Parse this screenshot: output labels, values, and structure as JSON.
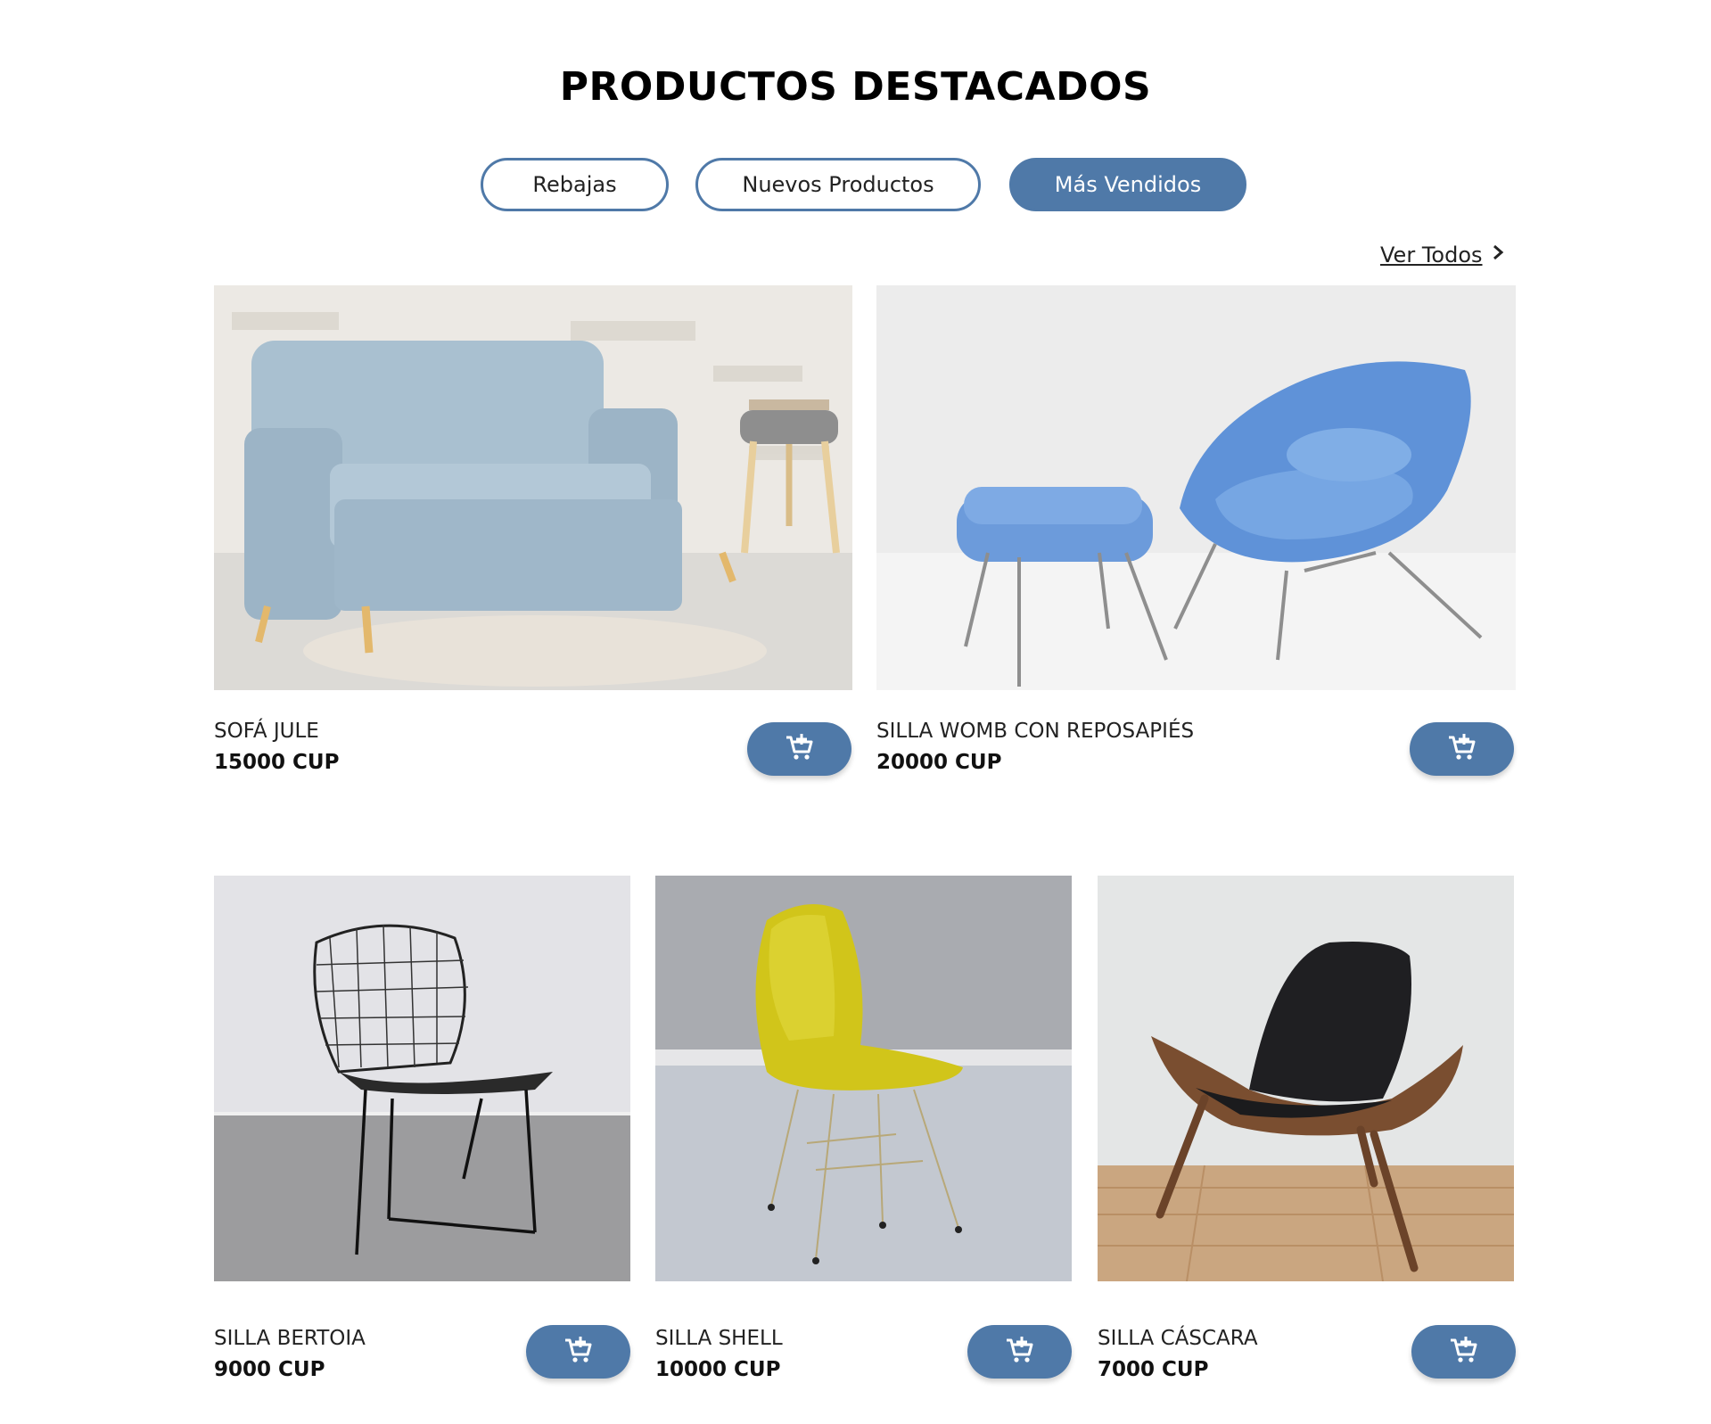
{
  "section": {
    "title": "PRODUCTOS DESTACADOS",
    "view_all": "Ver Todos"
  },
  "tabs": [
    {
      "label": "Rebajas",
      "active": false
    },
    {
      "label": "Nuevos Productos",
      "active": false
    },
    {
      "label": "Más Vendidos",
      "active": true
    }
  ],
  "products": [
    {
      "name": "SOFÁ JULE",
      "price": "15000 CUP",
      "image": "blue-sofa"
    },
    {
      "name": "SILLA WOMB CON REPOSAPIÉS",
      "price": "20000 CUP",
      "image": "blue-womb-chair-with-ottoman"
    },
    {
      "name": "SILLA BERTOIA",
      "price": "9000 CUP",
      "image": "black-wire-chair"
    },
    {
      "name": "SILLA SHELL",
      "price": "10000 CUP",
      "image": "yellow-shell-chair"
    },
    {
      "name": "SILLA CÁSCARA",
      "price": "7000 CUP",
      "image": "black-wood-lounge-chair"
    }
  ],
  "colors": {
    "accent": "#4f79a8",
    "text": "#111111"
  },
  "icons": {
    "cart": "add-to-cart-icon",
    "chevron": "chevron-right-icon"
  }
}
